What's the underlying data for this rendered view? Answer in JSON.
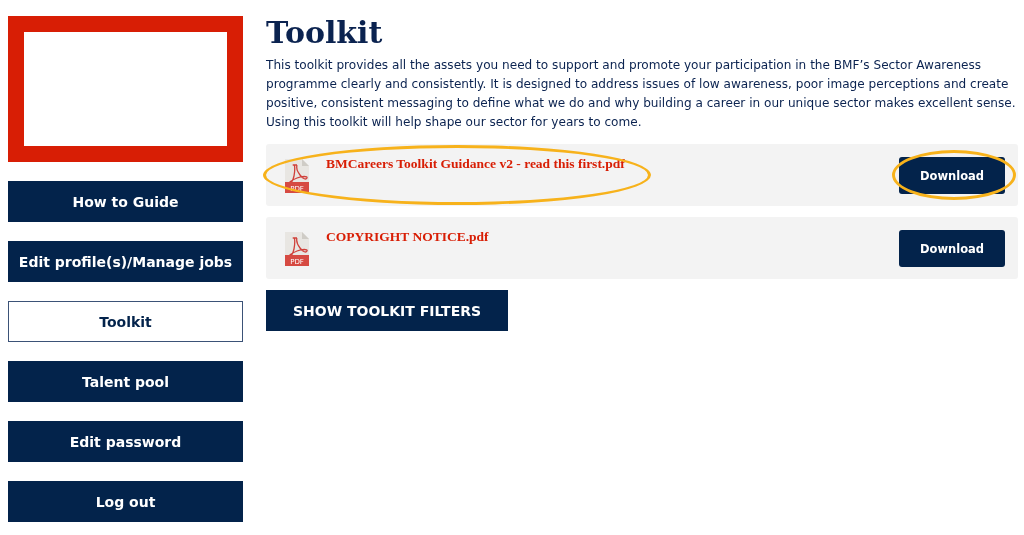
{
  "sidebar": {
    "items": [
      {
        "label": "How to Guide",
        "selected": false
      },
      {
        "label": "Edit profile(s)/Manage jobs",
        "selected": false
      },
      {
        "label": "Toolkit",
        "selected": true
      },
      {
        "label": "Talent pool",
        "selected": false
      },
      {
        "label": "Edit password",
        "selected": false
      },
      {
        "label": "Log out",
        "selected": false
      }
    ]
  },
  "main": {
    "title": "Toolkit",
    "intro": "This toolkit provides all the assets you need to support and promote your participation in the BMF’s Sector Awareness programme clearly and consistently. It is designed to address issues of low awareness, poor image perceptions and create positive, consistent messaging to define what we do and why building a career in our unique sector makes excellent sense. Using this toolkit will help shape our sector for years to come.",
    "files": [
      {
        "name": "BMCareers Toolkit Guidance v2 - read this first.pdf",
        "icon_label": "PDF",
        "button": "Download",
        "highlighted": true
      },
      {
        "name": "COPYRIGHT NOTICE.pdf",
        "icon_label": "PDF",
        "button": "Download",
        "highlighted": false
      }
    ],
    "filters_button": "SHOW TOOLKIT FILTERS"
  }
}
